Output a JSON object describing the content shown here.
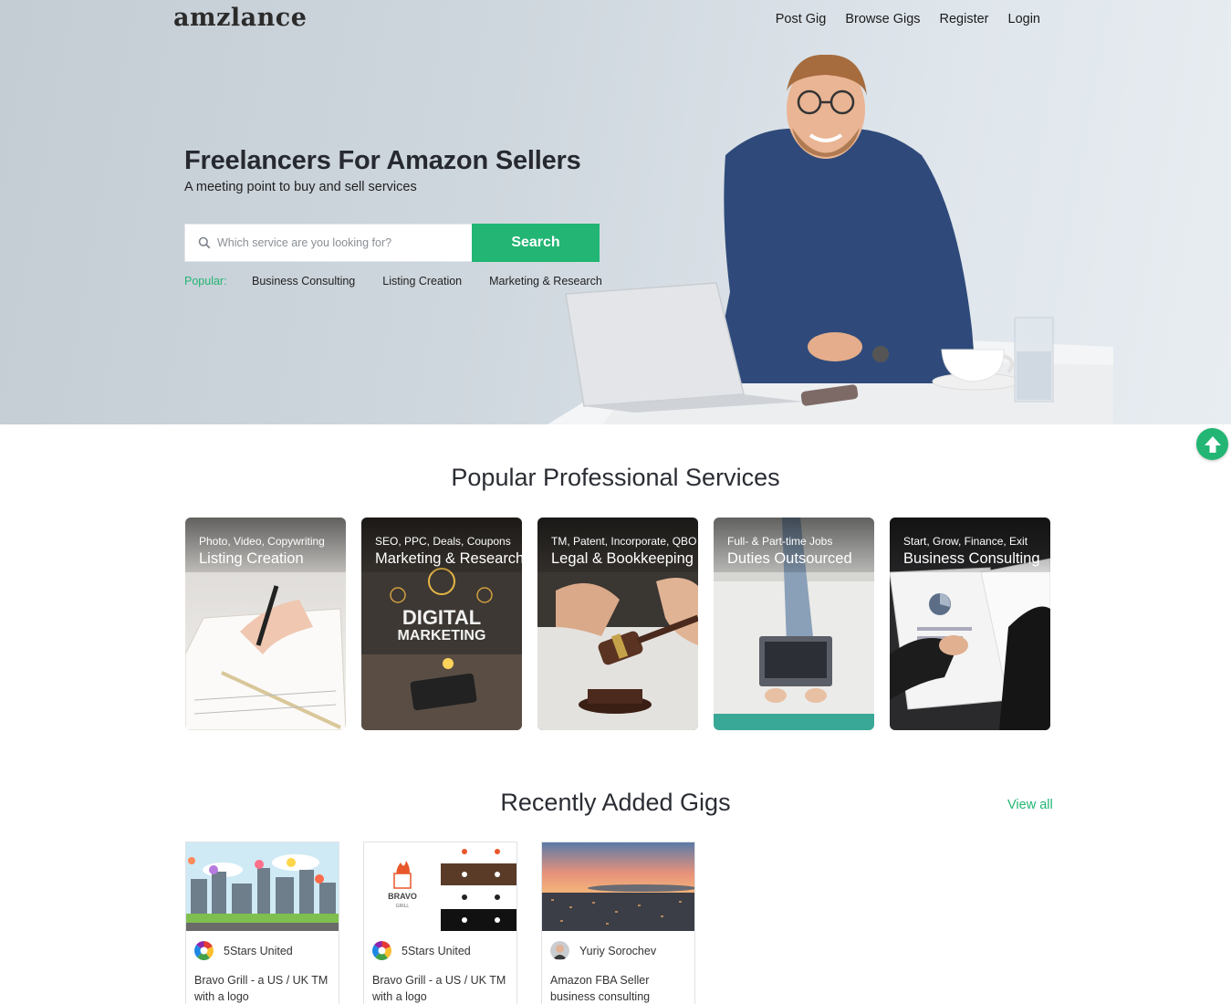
{
  "brand": {
    "logo": "amzlance",
    "accent_color": "#22b573"
  },
  "nav": {
    "items": [
      "Post Gig",
      "Browse Gigs",
      "Register",
      "Login"
    ]
  },
  "hero": {
    "title": "Freelancers For Amazon Sellers",
    "subtitle": "A meeting point to buy and sell services",
    "search": {
      "placeholder": "Which service are you looking for?",
      "button": "Search",
      "icon": "search-icon"
    },
    "popular_label": "Popular:",
    "popular_tags": [
      "Business Consulting",
      "Listing Creation",
      "Marketing & Research"
    ]
  },
  "services": {
    "title": "Popular Professional Services",
    "cards": [
      {
        "caption": "Photo, Video, Copywriting",
        "title": "Listing Creation"
      },
      {
        "caption": "SEO, PPC, Deals, Coupons",
        "title": "Marketing & Research",
        "image_text_1": "DIGITAL",
        "image_text_2": "MARKETING"
      },
      {
        "caption": "TM, Patent, Incorporate, QBO",
        "title": "Legal & Bookkeeping"
      },
      {
        "caption": "Full- & Part-time Jobs",
        "title": "Duties Outsourced"
      },
      {
        "caption": "Start, Grow, Finance, Exit",
        "title": "Business Consulting"
      }
    ]
  },
  "gigs": {
    "title": "Recently Added Gigs",
    "view_all": "View all",
    "items": [
      {
        "seller": "5Stars United",
        "title": "Bravo Grill - a US / UK TM with a logo"
      },
      {
        "seller": "5Stars United",
        "title": "Bravo Grill - a US / UK TM with a logo",
        "logo_text": "BRAVO",
        "logo_sub": "GRILL"
      },
      {
        "seller": "Yuriy Sorochev",
        "title": "Amazon FBA Seller business consulting"
      }
    ]
  },
  "scroll_top_icon": "arrow-up-icon"
}
